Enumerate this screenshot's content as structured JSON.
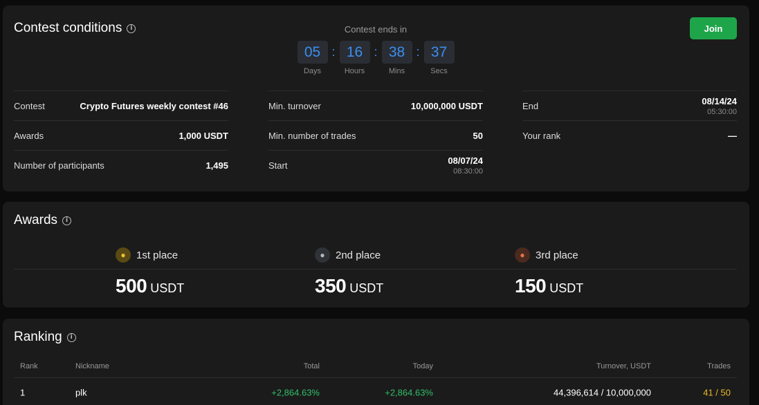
{
  "conditions": {
    "title": "Contest conditions",
    "countdown": {
      "title": "Contest ends in",
      "units": [
        {
          "value": "05",
          "label": "Days"
        },
        {
          "value": "16",
          "label": "Hours"
        },
        {
          "value": "38",
          "label": "Mins"
        },
        {
          "value": "37",
          "label": "Secs"
        }
      ]
    },
    "join_label": "Join",
    "col1": [
      {
        "label": "Contest",
        "value": "Crypto Futures weekly contest #46"
      },
      {
        "label": "Awards",
        "value": "1,000 USDT"
      },
      {
        "label": "Number of participants",
        "value": "1,495"
      }
    ],
    "col2": [
      {
        "label": "Min. turnover",
        "value": "10,000,000 USDT"
      },
      {
        "label": "Min. number of trades",
        "value": "50"
      },
      {
        "label": "Start",
        "value": "08/07/24",
        "sub": "08:30:00"
      }
    ],
    "col3": [
      {
        "label": "End",
        "value": "08/14/24",
        "sub": "05:30:00"
      },
      {
        "label": "Your rank",
        "value": "—"
      }
    ]
  },
  "awards": {
    "title": "Awards",
    "places": [
      {
        "label": "1st place",
        "amount": "500",
        "currency": "USDT",
        "icon": "gold-medal-icon",
        "color": "#f0c330"
      },
      {
        "label": "2nd place",
        "amount": "350",
        "currency": "USDT",
        "icon": "silver-medal-icon",
        "color": "#b5b8bd"
      },
      {
        "label": "3rd place",
        "amount": "150",
        "currency": "USDT",
        "icon": "bronze-medal-icon",
        "color": "#e2764a"
      }
    ]
  },
  "ranking": {
    "title": "Ranking",
    "columns": [
      "Rank",
      "Nickname",
      "Total",
      "Today",
      "Turnover, USDT",
      "Trades"
    ],
    "rows": [
      {
        "rank": "1",
        "nickname": "plk",
        "total": "+2,864.63%",
        "today": "+2,864.63%",
        "turnover": "44,396,614 / 10,000,000",
        "trades": "41 / 50"
      }
    ]
  },
  "colors": {
    "accent": "#3b8ef0",
    "join": "#1ea54a",
    "positive": "#2fbf6a",
    "trades": "#e9b829"
  }
}
